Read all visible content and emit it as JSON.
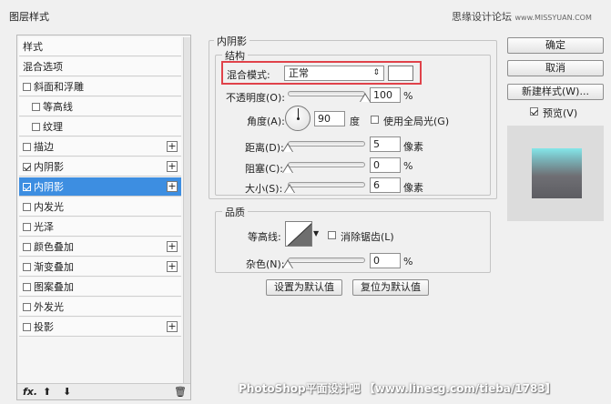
{
  "window": {
    "title": "图层样式"
  },
  "watermark_top": {
    "text": "思缘设计论坛",
    "site": "www.MISSYUAN.COM"
  },
  "watermark_bottom": "PhotoShop平面设计吧 【www.linecg.com/tieba/1783】",
  "left_panel": {
    "items": [
      {
        "label": "样式",
        "checkbox": false,
        "checked": false,
        "plus": false,
        "indent": false,
        "selected": false
      },
      {
        "label": "混合选项",
        "checkbox": false,
        "checked": false,
        "plus": false,
        "indent": false,
        "selected": false
      },
      {
        "label": "斜面和浮雕",
        "checkbox": true,
        "checked": false,
        "plus": false,
        "indent": false,
        "selected": false
      },
      {
        "label": "等高线",
        "checkbox": true,
        "checked": false,
        "plus": false,
        "indent": true,
        "selected": false
      },
      {
        "label": "纹理",
        "checkbox": true,
        "checked": false,
        "plus": false,
        "indent": true,
        "selected": false
      },
      {
        "label": "描边",
        "checkbox": true,
        "checked": false,
        "plus": true,
        "indent": false,
        "selected": false
      },
      {
        "label": "内阴影",
        "checkbox": true,
        "checked": true,
        "plus": true,
        "indent": false,
        "selected": false
      },
      {
        "label": "内阴影",
        "checkbox": true,
        "checked": true,
        "plus": true,
        "indent": false,
        "selected": true
      },
      {
        "label": "内发光",
        "checkbox": true,
        "checked": false,
        "plus": false,
        "indent": false,
        "selected": false
      },
      {
        "label": "光泽",
        "checkbox": true,
        "checked": false,
        "plus": false,
        "indent": false,
        "selected": false
      },
      {
        "label": "颜色叠加",
        "checkbox": true,
        "checked": false,
        "plus": true,
        "indent": false,
        "selected": false
      },
      {
        "label": "渐变叠加",
        "checkbox": true,
        "checked": false,
        "plus": true,
        "indent": false,
        "selected": false
      },
      {
        "label": "图案叠加",
        "checkbox": true,
        "checked": false,
        "plus": false,
        "indent": false,
        "selected": false
      },
      {
        "label": "外发光",
        "checkbox": true,
        "checked": false,
        "plus": false,
        "indent": false,
        "selected": false
      },
      {
        "label": "投影",
        "checkbox": true,
        "checked": false,
        "plus": true,
        "indent": false,
        "selected": false
      }
    ],
    "bottom_icons": {
      "fx": "fx.",
      "up": "⬆",
      "down": "⬇",
      "trash": "🗑"
    }
  },
  "inner_shadow": {
    "section_title": "内阴影",
    "structure": {
      "title": "结构",
      "blend_mode_label": "混合模式:",
      "blend_mode_value": "正常",
      "blend_color": "#ffffff",
      "opacity_label": "不透明度(O):",
      "opacity_value": "100",
      "opacity_unit": "%",
      "opacity_level": 1.0,
      "angle_label": "角度(A):",
      "angle_value": "90",
      "angle_unit": "度",
      "global_light_label": "使用全局光(G)",
      "distance_label": "距离(D):",
      "distance_value": "5",
      "distance_unit": "像素",
      "distance_level": 0.0,
      "choke_label": "阻塞(C):",
      "choke_value": "0",
      "choke_unit": "%",
      "choke_level": 0.0,
      "size_label": "大小(S):",
      "size_value": "6",
      "size_unit": "像素",
      "size_level": 0.02
    },
    "quality": {
      "title": "品质",
      "contour_label": "等高线:",
      "antialias_label": "消除锯齿(L)",
      "noise_label": "杂色(N):",
      "noise_value": "0",
      "noise_unit": "%",
      "noise_level": 0.0
    },
    "set_default_button": "设置为默认值",
    "reset_default_button": "复位为默认值"
  },
  "right_panel": {
    "ok_button": "确定",
    "cancel_button": "取消",
    "new_style_button": "新建样式(W)...",
    "preview_label": "预览(V)",
    "preview_checked": true
  }
}
